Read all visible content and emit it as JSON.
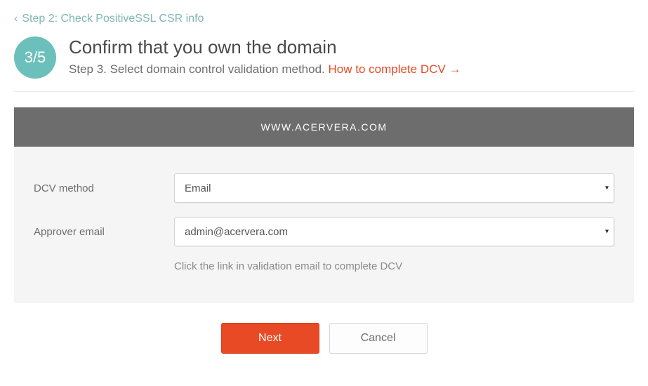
{
  "back_link": "Step 2: Check PositiveSSL CSR info",
  "step_badge": "3/5",
  "title": "Confirm that you own the domain",
  "subtitle_prefix": "Step 3. Select domain control validation method. ",
  "help_link": "How to complete DCV →",
  "panel_header": "WWW.ACERVERA.COM",
  "form": {
    "dcv_method_label": "DCV method",
    "dcv_method_value": "Email",
    "approver_email_label": "Approver email",
    "approver_email_value": "admin@acervera.com",
    "hint": "Click the link in validation email to complete DCV"
  },
  "actions": {
    "next": "Next",
    "cancel": "Cancel"
  }
}
